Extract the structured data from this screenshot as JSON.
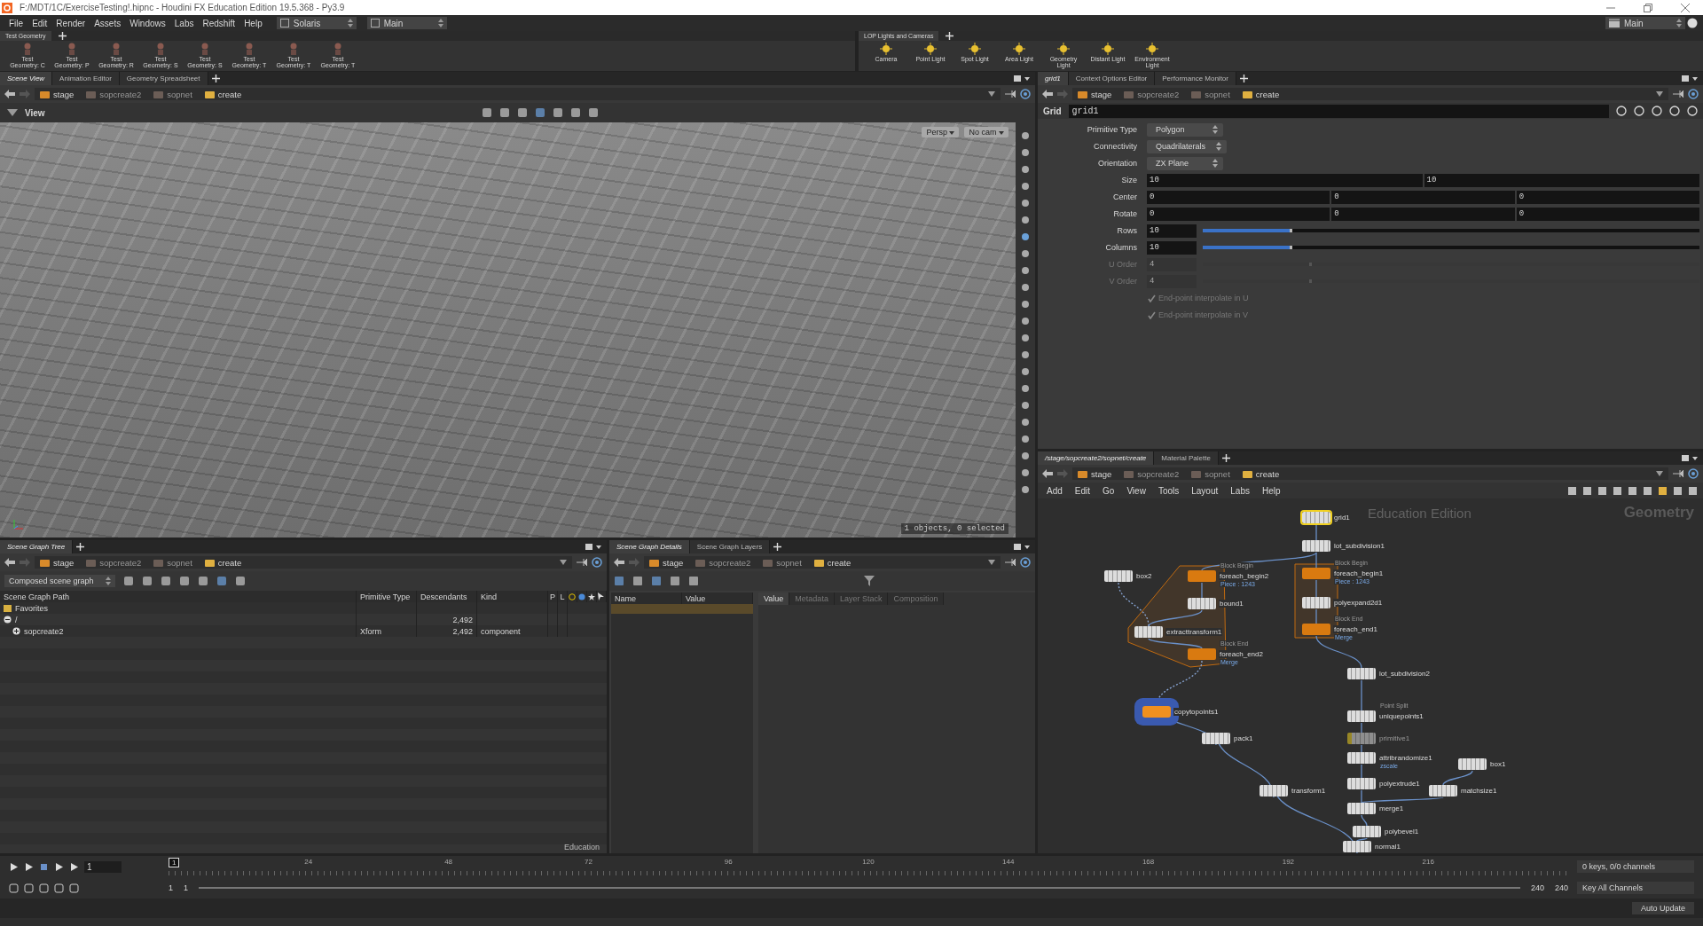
{
  "window": {
    "title": "F:/MDT/1C/ExerciseTesting!.hipnc - Houdini FX Education Edition 19.5.368 - Py3.9"
  },
  "menu": [
    "File",
    "Edit",
    "Render",
    "Assets",
    "Windows",
    "Labs",
    "Redshift",
    "Help"
  ],
  "desktop_menus": [
    "Solaris",
    "Main"
  ],
  "context_menu": "Main",
  "shelves": [
    {
      "tab": "Test Geometry",
      "tools": [
        "Test Geometry: C",
        "Test Geometry: P",
        "Test Geometry: R",
        "Test Geometry: S",
        "Test Geometry: S",
        "Test Geometry: T",
        "Test Geometry: T",
        "Test Geometry: T"
      ]
    },
    {
      "tab": "LOP Lights and Cameras",
      "tools": [
        "Camera",
        "Point Light",
        "Spot Light",
        "Area Light",
        "Geometry Light",
        "Distant Light",
        "Environment Light"
      ]
    }
  ],
  "viewport": {
    "tabs": [
      {
        "label": "Scene View",
        "selected": true
      },
      {
        "label": "Animation Editor",
        "selected": false
      },
      {
        "label": "Geometry Spreadsheet",
        "selected": false
      }
    ],
    "path": [
      "stage",
      "sopcreate2",
      "sopnet",
      "create"
    ],
    "label": "View",
    "camera_menus": [
      "Persp",
      "No cam"
    ],
    "status": "1 objects, 0 selected"
  },
  "parameters": {
    "tabs": [
      {
        "label": "grid1",
        "selected": true
      },
      {
        "label": "Context Options Editor",
        "selected": false
      },
      {
        "label": "Performance Monitor",
        "selected": false
      }
    ],
    "path": [
      "stage",
      "sopcreate2",
      "sopnet",
      "create"
    ],
    "node_type": "Grid",
    "node_name": "grid1",
    "parms": [
      {
        "kind": "menu",
        "label": "Primitive Type",
        "value": "Polygon"
      },
      {
        "kind": "menu",
        "label": "Connectivity",
        "value": "Quadrilaterals"
      },
      {
        "kind": "menu",
        "label": "Orientation",
        "value": "ZX Plane"
      },
      {
        "kind": "vector",
        "label": "Size",
        "values": [
          "10",
          "10"
        ]
      },
      {
        "kind": "vector",
        "label": "Center",
        "values": [
          "0",
          "0",
          "0"
        ]
      },
      {
        "kind": "vector",
        "label": "Rotate",
        "values": [
          "0",
          "0",
          "0"
        ]
      },
      {
        "kind": "slider",
        "label": "Rows",
        "value": "10",
        "level": 0.18,
        "disabled": false
      },
      {
        "kind": "slider",
        "label": "Columns",
        "value": "10",
        "level": 0.18,
        "disabled": false
      },
      {
        "kind": "slider",
        "label": "U Order",
        "value": "4",
        "level": 0.22,
        "disabled": true
      },
      {
        "kind": "slider",
        "label": "V Order",
        "value": "4",
        "level": 0.22,
        "disabled": true
      },
      {
        "kind": "checkbox",
        "label": "End-point interpolate in U",
        "checked": true,
        "disabled": true
      },
      {
        "kind": "checkbox",
        "label": "End-point interpolate in V",
        "checked": true,
        "disabled": true
      }
    ]
  },
  "network": {
    "tabs": [
      {
        "label": "/stage/sopcreate2/sopnet/create",
        "selected": true
      },
      {
        "label": "Material Palette",
        "selected": false
      }
    ],
    "path": [
      "stage",
      "sopcreate2",
      "sopnet",
      "create"
    ],
    "menu": [
      "Add",
      "Edit",
      "Go",
      "View",
      "Tools",
      "Layout",
      "Labs",
      "Help"
    ],
    "edition_label": "Education Edition",
    "context_label": "Geometry",
    "nodes": [
      {
        "name": "grid1",
        "kind": "node",
        "selected": true,
        "bypassed": false
      },
      {
        "name": "lot_subdivision1",
        "kind": "node",
        "selected": false,
        "bypassed": false
      },
      {
        "name": "box2",
        "kind": "node",
        "selected": false,
        "bypassed": false
      },
      {
        "name": "foreach_begin2",
        "kind": "block",
        "header": "Block Begin",
        "note": "Piece : 1243",
        "selected": false,
        "bypassed": false
      },
      {
        "name": "bound1",
        "kind": "node",
        "selected": false,
        "bypassed": false
      },
      {
        "name": "extracttransform1",
        "kind": "node",
        "selected": false,
        "bypassed": false
      },
      {
        "name": "foreach_end2",
        "kind": "block",
        "header": "Block End",
        "note": "Merge",
        "selected": false,
        "bypassed": false
      },
      {
        "name": "foreach_begin1",
        "kind": "block",
        "header": "Block Begin",
        "note": "Piece : 1243",
        "selected": false,
        "bypassed": false
      },
      {
        "name": "polyexpand2d1",
        "kind": "node",
        "selected": false,
        "bypassed": false
      },
      {
        "name": "foreach_end1",
        "kind": "block",
        "header": "Block End",
        "note": "Merge",
        "selected": false,
        "bypassed": false
      },
      {
        "name": "lot_subdivision2",
        "kind": "node",
        "selected": false,
        "bypassed": false
      },
      {
        "name": "copytopoints1",
        "kind": "copy",
        "selected": false,
        "bypassed": false
      },
      {
        "name": "uniquepoints1",
        "kind": "node",
        "header": "Point Split",
        "selected": false,
        "bypassed": false
      },
      {
        "name": "pack1",
        "kind": "node",
        "selected": false,
        "bypassed": false
      },
      {
        "name": "primitive1",
        "kind": "node",
        "selected": false,
        "bypassed": true
      },
      {
        "name": "attribrandomize1",
        "kind": "node",
        "note": "zscale",
        "selected": false,
        "bypassed": false
      },
      {
        "name": "box1",
        "kind": "node",
        "selected": false,
        "bypassed": false
      },
      {
        "name": "polyextrude1",
        "kind": "node",
        "selected": false,
        "bypassed": false
      },
      {
        "name": "transform1",
        "kind": "node",
        "selected": false,
        "bypassed": false
      },
      {
        "name": "matchsize1",
        "kind": "node",
        "selected": false,
        "bypassed": false
      },
      {
        "name": "merge1",
        "kind": "node",
        "selected": false,
        "bypassed": false
      },
      {
        "name": "polybevel1",
        "kind": "node",
        "selected": false,
        "bypassed": false
      },
      {
        "name": "normal1",
        "kind": "node",
        "selected": false,
        "bypassed": false
      }
    ]
  },
  "scene_graph_tree": {
    "tabs": [
      {
        "label": "Scene Graph Tree",
        "selected": true
      }
    ],
    "path": [
      "stage",
      "sopcreate2",
      "sopnet",
      "create"
    ],
    "view_menu": "Composed scene graph",
    "columns": [
      "Scene Graph Path",
      "Primitive Type",
      "Descendants",
      "Kind",
      "P",
      "L"
    ],
    "rows": [
      {
        "label": "Favorites"
      },
      {
        "label": "/",
        "descendants": "2,492",
        "expanded": true,
        "children": [
          {
            "label": "sopcreate2",
            "type": "Xform",
            "descendants": "2,492",
            "kind": "component",
            "expanded": false
          }
        ]
      }
    ],
    "footer": "Education"
  },
  "scene_graph_details": {
    "tabs": [
      {
        "label": "Scene Graph Details",
        "selected": true
      },
      {
        "label": "Scene Graph Layers",
        "selected": false
      }
    ],
    "path": [
      "stage",
      "sopcreate2",
      "sopnet",
      "create"
    ],
    "columns": [
      "Name",
      "Value"
    ],
    "detail_tabs": [
      {
        "label": "Value",
        "selected": true
      },
      {
        "label": "Metadata",
        "selected": false
      },
      {
        "label": "Layer Stack",
        "selected": false
      },
      {
        "label": "Composition",
        "selected": false
      }
    ]
  },
  "timeline": {
    "frame": "1",
    "current_frame": "1",
    "ticks": [
      "24",
      "48",
      "72",
      "96",
      "120",
      "144",
      "168",
      "192",
      "216"
    ],
    "start": [
      "1",
      "1"
    ],
    "end": [
      "240",
      "240"
    ],
    "keys_status": "0 keys, 0/0 channels",
    "key_button": "Key All Channels",
    "update_mode": "Auto Update"
  }
}
